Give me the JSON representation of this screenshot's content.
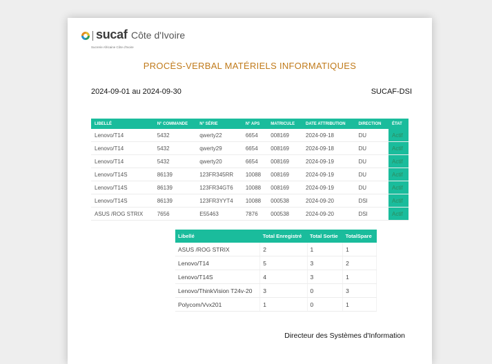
{
  "header": {
    "brand": "sucaf",
    "country": "Côte d'Ivoire",
    "subtitle": "Sucrerie Africaine Côte d'Ivoire"
  },
  "title": "PROCÈS-VERBAL MATÉRIELS INFORMATIQUES",
  "period": "2024-09-01 au 2024-09-30",
  "department": "SUCAF-DSI",
  "equipment_table": {
    "headers": [
      "LIBELLÉ",
      "N° COMMANDE",
      "N° SÉRIE",
      "N° APS",
      "MATRICULE",
      "DATE ATTRIBUTION",
      "DIRECTION",
      "ÉTAT"
    ],
    "rows": [
      [
        "Lenovo/T14",
        "5432",
        "qwerty22",
        "6654",
        "008169",
        "2024-09-18",
        "DU",
        "Actif"
      ],
      [
        "Lenovo/T14",
        "5432",
        "qwerty29",
        "6654",
        "008169",
        "2024-09-18",
        "DU",
        "Actif"
      ],
      [
        "Lenovo/T14",
        "5432",
        "qwerty20",
        "6654",
        "008169",
        "2024-09-19",
        "DU",
        "Actif"
      ],
      [
        "Lenovo/T14S",
        "86139",
        "123FR345RR",
        "10088",
        "008169",
        "2024-09-19",
        "DU",
        "Actif"
      ],
      [
        "Lenovo/T14S",
        "86139",
        "123FR34GT6",
        "10088",
        "008169",
        "2024-09-19",
        "DU",
        "Actif"
      ],
      [
        "Lenovo/T14S",
        "86139",
        "123FR3YYT4",
        "10088",
        "000538",
        "2024-09-20",
        "DSI",
        "Actif"
      ],
      [
        "ASUS /ROG STRIX",
        "7656",
        "E55463",
        "7876",
        "000538",
        "2024-09-20",
        "DSI",
        "Actif"
      ]
    ]
  },
  "summary_table": {
    "headers": [
      "Libellé",
      "Total Enregistré",
      "Total Sortie",
      "TotalSpare"
    ],
    "rows": [
      [
        "ASUS /ROG STRIX",
        "2",
        "1",
        "1"
      ],
      [
        "Lenovo/T14",
        "5",
        "3",
        "2"
      ],
      [
        "Lenovo/T14S",
        "4",
        "3",
        "1"
      ],
      [
        "Lenovo/ThinkVision T24v-20",
        "3",
        "0",
        "3"
      ],
      [
        "Polycom/Vvx201",
        "1",
        "0",
        "1"
      ]
    ]
  },
  "signature": "Directeur des Systèmes d'Information",
  "colors": {
    "accent": "#1abc9c",
    "title": "#c07a1a"
  }
}
